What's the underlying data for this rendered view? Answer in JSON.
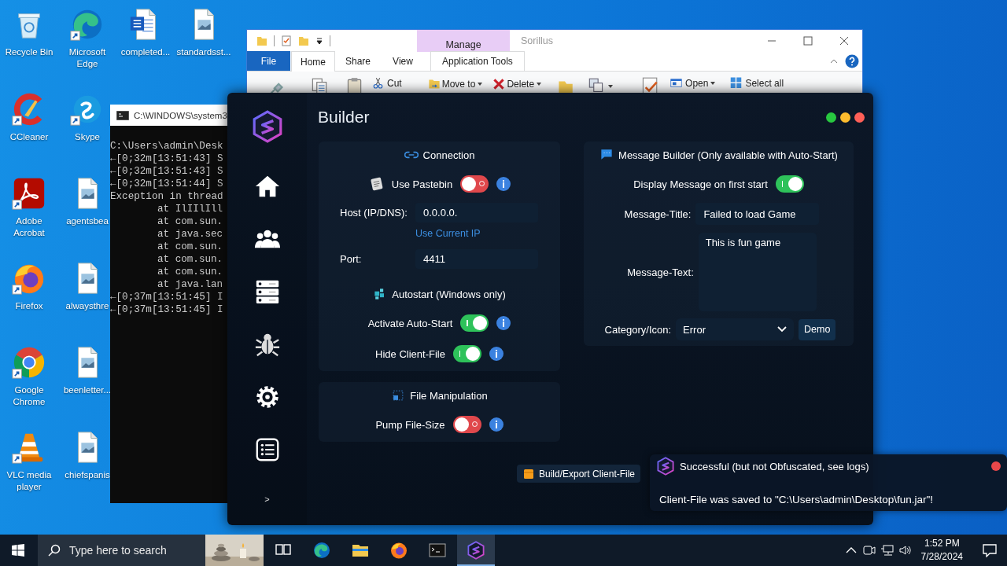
{
  "desktop": {
    "columns": [
      [
        {
          "label": "Recycle Bin",
          "kind": "recycle_bin",
          "shortcut": false
        },
        {
          "label": "CCleaner",
          "kind": "ccleaner",
          "shortcut": true
        },
        {
          "label": "Adobe Acrobat",
          "kind": "acrobat",
          "shortcut": true
        },
        {
          "label": "Firefox",
          "kind": "firefox",
          "shortcut": true
        },
        {
          "label": "Google Chrome",
          "kind": "chrome",
          "shortcut": true
        },
        {
          "label": "VLC media player",
          "kind": "vlc",
          "shortcut": true
        }
      ],
      [
        {
          "label": "Microsoft Edge",
          "kind": "edge",
          "shortcut": true
        },
        {
          "label": "Skype",
          "kind": "skype",
          "shortcut": true
        },
        {
          "label": "agentsbea",
          "kind": "image_file",
          "shortcut": false
        },
        {
          "label": "alwaysthre",
          "kind": "image_file",
          "shortcut": false
        },
        {
          "label": "beenletter...",
          "kind": "image_file",
          "shortcut": false
        },
        {
          "label": "chiefspanis",
          "kind": "image_file",
          "shortcut": false
        }
      ],
      [
        {
          "label": "completed...",
          "kind": "word_file",
          "shortcut": false
        }
      ],
      [
        {
          "label": "standardsst...",
          "kind": "image_file",
          "shortcut": false
        }
      ]
    ]
  },
  "console_window": {
    "title": "C:\\WINDOWS\\system3",
    "lines": [
      {
        "text": "C:\\Users\\admin\\Desk",
        "indented": false
      },
      {
        "text": "←[0;32m[13:51:43] S",
        "indented": false
      },
      {
        "text": "←[0;32m[13:51:43] S",
        "indented": false
      },
      {
        "text": "←[0;32m[13:51:44] S",
        "indented": false
      },
      {
        "text": "Exception in thread",
        "indented": false
      },
      {
        "text": "at IlIIlIll",
        "indented": true
      },
      {
        "text": "at com.sun.",
        "indented": true
      },
      {
        "text": "at java.sec",
        "indented": true
      },
      {
        "text": "at com.sun.",
        "indented": true
      },
      {
        "text": "at com.sun.",
        "indented": true
      },
      {
        "text": "at com.sun.",
        "indented": true
      },
      {
        "text": "at java.lan",
        "indented": true
      },
      {
        "text": "←[0;37m[13:51:45] I",
        "indented": false
      },
      {
        "text": "←[0;37m[13:51:45] I",
        "indented": false
      }
    ]
  },
  "explorer_window": {
    "context_tab": "Manage",
    "title": "Sorillus",
    "tabs": [
      {
        "label": "File",
        "kind": "file",
        "selected": false
      },
      {
        "label": "Home",
        "kind": "tab",
        "selected": true
      },
      {
        "label": "Share",
        "kind": "tab",
        "selected": false
      },
      {
        "label": "View",
        "kind": "tab",
        "selected": false
      },
      {
        "label": "Application Tools",
        "kind": "context",
        "selected": false
      }
    ],
    "ribbon": [
      {
        "kind": "pin"
      },
      {
        "kind": "copy"
      },
      {
        "kind": "paste"
      },
      {
        "kind": "cut",
        "label": "Cut",
        "dropdown": false
      },
      {
        "kind": "move",
        "label": "Move to",
        "dropdown": true
      },
      {
        "kind": "delete",
        "label": "Delete",
        "dropdown": true
      },
      {
        "kind": "new_folder"
      },
      {
        "kind": "copy_path",
        "dropdown": true
      },
      {
        "kind": "properties"
      },
      {
        "kind": "open",
        "label": "Open",
        "dropdown": true
      },
      {
        "kind": "select_all",
        "label": "Select all",
        "dropdown": false
      }
    ]
  },
  "builder": {
    "title": "Builder",
    "nav": [
      {
        "kind": "home"
      },
      {
        "kind": "users"
      },
      {
        "kind": "server"
      },
      {
        "kind": "bug"
      },
      {
        "kind": "gear"
      },
      {
        "kind": "list"
      }
    ],
    "expand": ">",
    "left_cards": [
      {
        "sections": [
          {
            "title": "Connection",
            "rows": [
              {
                "kind": "toggle",
                "label": "Use Pastebin",
                "on": false,
                "info": true
              },
              {
                "kind": "field",
                "label": "Host (IP/DNS):",
                "value": "0.0.0.0."
              },
              {
                "kind": "link",
                "label": "Use Current IP"
              },
              {
                "kind": "field",
                "label": "Port:",
                "value": "4411"
              }
            ]
          },
          {
            "title": "Autostart (Windows only)",
            "rows": [
              {
                "kind": "toggle",
                "label": "Activate Auto-Start",
                "on": true,
                "info": true
              },
              {
                "kind": "toggle",
                "label": "Hide Client-File",
                "on": true,
                "info": true
              }
            ]
          }
        ]
      },
      {
        "sections": [
          {
            "title": "File Manipulation",
            "rows": [
              {
                "kind": "toggle",
                "label": "Pump File-Size",
                "on": false,
                "info": true
              }
            ]
          }
        ]
      }
    ],
    "right_card": {
      "sections": [
        {
          "title": "Message Builder (Only available with Auto-Start)",
          "rows": [
            {
              "kind": "toggle",
              "label": "Display Message on first start",
              "on": true
            },
            {
              "kind": "field",
              "label": "Message-Title:",
              "value": "Failed to load Game"
            },
            {
              "kind": "textarea",
              "label": "Message-Text:",
              "value": "This is fun game"
            },
            {
              "kind": "select",
              "label": "Category/Icon:",
              "value": "Error",
              "button": "Demo"
            }
          ]
        }
      ]
    },
    "build_button": "Build/Export Client-File"
  },
  "toast": {
    "title": "Successful (but not Obfuscated, see logs)",
    "message": "Client-File was saved to \"C:\\Users\\admin\\Desktop\\fun.jar\"!"
  },
  "taskbar": {
    "search_placeholder": "Type here to search",
    "apps": [
      {
        "kind": "task_view",
        "active": false
      },
      {
        "kind": "edge",
        "active": false
      },
      {
        "kind": "explorer",
        "active": false
      },
      {
        "kind": "firefox",
        "active": false
      },
      {
        "kind": "terminal",
        "active": false
      },
      {
        "kind": "sorillus",
        "active": true
      }
    ],
    "time": "1:52 PM",
    "date": "7/28/2024"
  }
}
